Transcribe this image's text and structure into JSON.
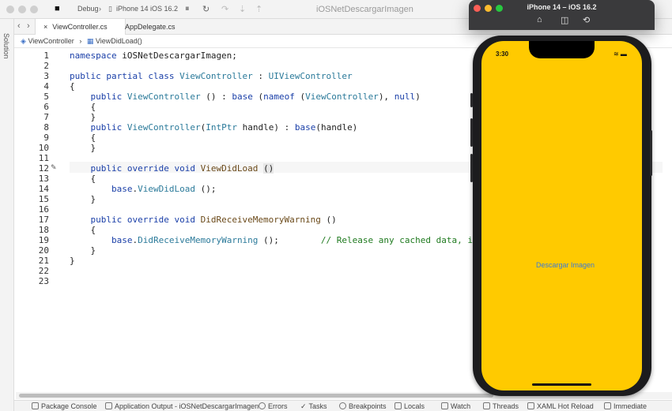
{
  "titlebar": {
    "config": "Debug",
    "device": "iPhone 14 iOS 16.2",
    "window_title": "iOSNetDescargarImagen"
  },
  "sidebar": {
    "solution_label": "Solution"
  },
  "tabs": [
    {
      "label": "ViewController.cs",
      "active": true
    },
    {
      "label": "AppDelegate.cs",
      "active": false
    }
  ],
  "breadcrumb": {
    "class_name": "ViewController",
    "method_name": "ViewDidLoad()"
  },
  "editor": {
    "line_numbers": [
      "1",
      "2",
      "3",
      "4",
      "5",
      "6",
      "7",
      "8",
      "9",
      "10",
      "11",
      "12",
      "13",
      "14",
      "15",
      "16",
      "17",
      "18",
      "19",
      "20",
      "21",
      "22",
      "23"
    ],
    "current_line": 12
  },
  "bottom_pads": [
    {
      "label": "Package Console",
      "icon": "terminal-icon"
    },
    {
      "label": "Application Output - iOSNetDescargarImagen",
      "icon": "output-icon"
    },
    {
      "label": "Errors",
      "icon": "error-icon"
    },
    {
      "label": "Tasks",
      "icon": "check-icon"
    },
    {
      "label": "Breakpoints",
      "icon": "breakpoint-icon"
    },
    {
      "label": "Locals",
      "icon": "locals-icon"
    },
    {
      "label": "Watch",
      "icon": "watch-icon"
    },
    {
      "label": "Threads",
      "icon": "threads-icon"
    },
    {
      "label": "XAML Hot Reload",
      "icon": "reload-icon"
    },
    {
      "label": "Immediate",
      "icon": "immediate-icon"
    }
  ],
  "simulator": {
    "title": "iPhone 14 – iOS 16.2",
    "time": "3:30",
    "button_label": "Descargar Imagen",
    "screen_color": "#FFCA00",
    "button_color": "#3B7BD8"
  }
}
